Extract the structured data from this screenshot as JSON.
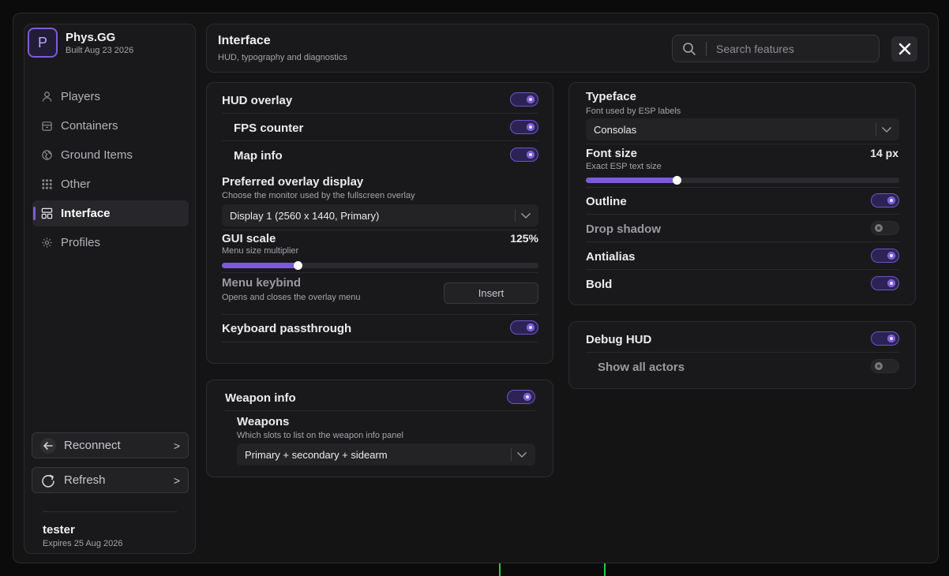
{
  "brand": {
    "logo_letter": "P",
    "name": "Phys.GG",
    "build": "Built Aug 23 2026"
  },
  "nav": {
    "items": [
      {
        "label": "Players",
        "icon": "user-icon",
        "active": false
      },
      {
        "label": "Containers",
        "icon": "box-icon",
        "active": false
      },
      {
        "label": "Ground Items",
        "icon": "globe-icon",
        "active": false
      },
      {
        "label": "Other",
        "icon": "grid-icon",
        "active": false
      },
      {
        "label": "Interface",
        "icon": "layout-icon",
        "active": true
      },
      {
        "label": "Profiles",
        "icon": "gear-icon",
        "active": false
      }
    ]
  },
  "sidebar_actions": {
    "reconnect": {
      "label": "Reconnect",
      "icon": "arrow-left-icon",
      "chevron": ">"
    },
    "refresh": {
      "label": "Refresh",
      "icon": "refresh-icon",
      "chevron": ">"
    }
  },
  "user": {
    "name": "tester",
    "expires": "Expires 25 Aug 2026"
  },
  "header": {
    "title": "Interface",
    "subtitle": "HUD, typography and diagnostics",
    "search_placeholder": "Search features"
  },
  "hud": {
    "overlay_label": "HUD overlay",
    "overlay_on": true,
    "fps_label": "FPS counter",
    "fps_on": true,
    "map_label": "Map info",
    "map_on": true,
    "display_label": "Preferred overlay display",
    "display_sub": "Choose the monitor used by the fullscreen overlay",
    "display_value": "Display 1 (2560 x 1440, Primary)",
    "scale_label": "GUI scale",
    "scale_sub": "Menu size multiplier",
    "scale_value": "125%",
    "scale_fraction": 0.24,
    "keybind_label": "Menu keybind",
    "keybind_sub": "Opens and closes the overlay menu",
    "keybind_value": "Insert",
    "passthrough_label": "Keyboard passthrough",
    "passthrough_on": true
  },
  "weapon": {
    "label": "Weapon info",
    "on": true,
    "weapons_label": "Weapons",
    "weapons_sub": "Which slots to list on the weapon info panel",
    "weapons_value": "Primary + secondary + sidearm"
  },
  "typeface": {
    "label": "Typeface",
    "sub": "Font used by ESP labels",
    "value": "Consolas",
    "size_label": "Font size",
    "size_sub": "Exact ESP text size",
    "size_value": "14 px",
    "size_fraction": 0.29,
    "outline_label": "Outline",
    "outline_on": true,
    "shadow_label": "Drop shadow",
    "shadow_on": false,
    "antialias_label": "Antialias",
    "antialias_on": true,
    "bold_label": "Bold",
    "bold_on": true
  },
  "debug": {
    "label": "Debug HUD",
    "on": true,
    "actors_label": "Show all actors",
    "actors_on": false
  },
  "colors": {
    "accent": "#7c5cd6",
    "panel": "#19191b",
    "window": "#141415",
    "bg_line": "#1fcf4a"
  }
}
